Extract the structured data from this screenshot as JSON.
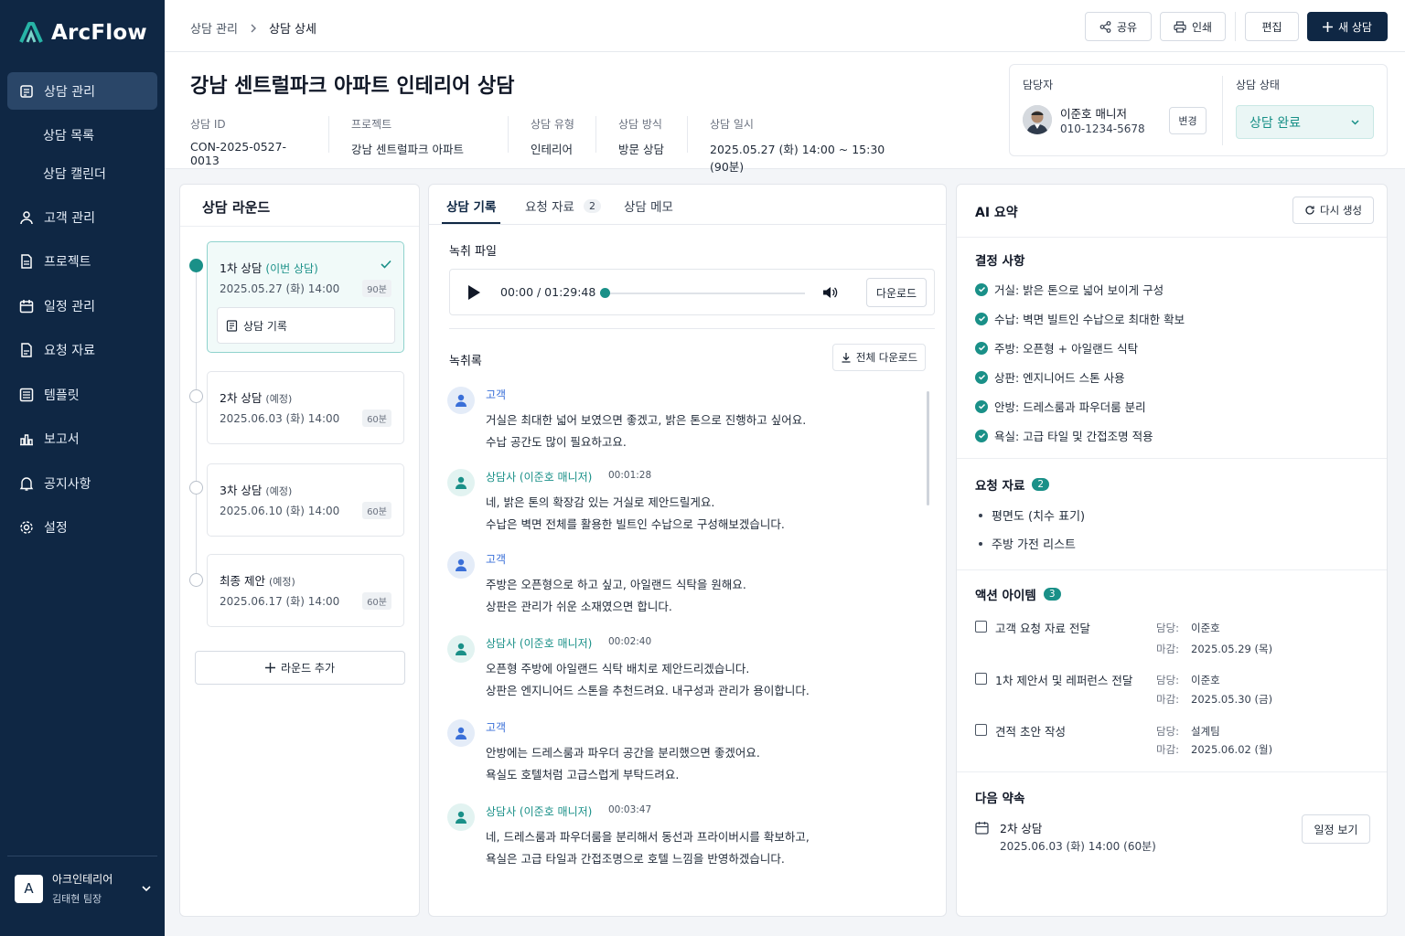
{
  "app": {
    "name": "ArcFlow"
  },
  "sidebar": {
    "items": [
      {
        "label": "상담 관리",
        "icon": "consult-icon",
        "active": true
      },
      {
        "label": "상담 목록",
        "sub": true
      },
      {
        "label": "상담 캘린더",
        "sub": true
      },
      {
        "label": "고객 관리",
        "icon": "user-icon"
      },
      {
        "label": "프로젝트",
        "icon": "document-icon"
      },
      {
        "label": "일정 관리",
        "icon": "calendar-icon"
      },
      {
        "label": "요청 자료",
        "icon": "file-icon"
      },
      {
        "label": "템플릿",
        "icon": "template-icon"
      },
      {
        "label": "보고서",
        "icon": "chart-icon"
      },
      {
        "label": "공지사항",
        "icon": "bell-icon"
      },
      {
        "label": "설정",
        "icon": "gear-icon"
      }
    ],
    "org": {
      "initial": "A",
      "name": "아크인테리어",
      "user": "김태현 팀장"
    }
  },
  "topbar": {
    "breadcrumb": [
      "상담 관리",
      "상담 상세"
    ],
    "share": "공유",
    "print": "인쇄",
    "edit": "편집",
    "new": "새 상담"
  },
  "header": {
    "title": "강남 센트럴파크 아파트 인테리어 상담",
    "meta": [
      {
        "label": "상담 ID",
        "value": "CON-2025-0527-0013"
      },
      {
        "label": "프로젝트",
        "value": "강남 센트럴파크 아파트"
      },
      {
        "label": "상담 유형",
        "value": "인테리어"
      },
      {
        "label": "상담 방식",
        "value": "방문 상담"
      },
      {
        "label": "상담 일시",
        "value": "2025.05.27 (화) 14:00 ~ 15:30 (90분)"
      }
    ],
    "owner_label": "담당자",
    "owner_name": "이준호 매니저",
    "owner_phone": "010-1234-5678",
    "change": "변경",
    "status_label": "상담 상태",
    "status": "상담 완료"
  },
  "rounds": {
    "title": "상담 라운드",
    "items": [
      {
        "title": "1차 상담",
        "tag": "(이번 상담)",
        "date": "2025.05.27 (화) 14:00",
        "dur": "90분",
        "record": "상담 기록"
      },
      {
        "title": "2차 상담",
        "tag": "(예정)",
        "date": "2025.06.03 (화) 14:00",
        "dur": "60분"
      },
      {
        "title": "3차 상담",
        "tag": "(예정)",
        "date": "2025.06.10 (화) 14:00",
        "dur": "60분"
      },
      {
        "title": "최종 제안",
        "tag": "(예정)",
        "date": "2025.06.17 (화) 14:00",
        "dur": "60분"
      }
    ],
    "add": "라운드 추가"
  },
  "records": {
    "tabs": [
      {
        "label": "상담 기록"
      },
      {
        "label": "요청 자료",
        "count": "2"
      },
      {
        "label": "상담 메모"
      }
    ],
    "audio_label": "녹취 파일",
    "audio_time": "00:00 / 01:29:48",
    "audio_progress": 0,
    "audio_download": "다운로드",
    "transcript_label": "녹취록",
    "download_all": "전체 다운로드",
    "messages": [
      {
        "who": "고객",
        "type": "cust",
        "ts": "",
        "lines": [
          "거실은 최대한 넓어 보였으면 좋겠고, 밝은 톤으로 진행하고 싶어요.",
          "수납 공간도 많이 필요하고요."
        ]
      },
      {
        "who": "상담사 (이준호 매니저)",
        "type": "agent",
        "ts": "00:01:28",
        "lines": [
          "네, 밝은 톤의 확장감 있는 거실로 제안드릴게요.",
          "수납은 벽면 전체를 활용한 빌트인 수납으로 구성해보겠습니다."
        ]
      },
      {
        "who": "고객",
        "type": "cust",
        "ts": "",
        "lines": [
          "주방은 오픈형으로 하고 싶고, 아일랜드 식탁을 원해요.",
          "상판은 관리가 쉬운 소재였으면 합니다."
        ]
      },
      {
        "who": "상담사 (이준호 매니저)",
        "type": "agent",
        "ts": "00:02:40",
        "lines": [
          "오픈형 주방에 아일랜드 식탁 배치로 제안드리겠습니다.",
          "상판은 엔지니어드 스톤을 추천드려요. 내구성과 관리가 용이합니다."
        ]
      },
      {
        "who": "고객",
        "type": "cust",
        "ts": "",
        "lines": [
          "안방에는 드레스룸과 파우더 공간을 분리했으면 좋겠어요.",
          "욕실도 호텔처럼 고급스럽게 부탁드려요."
        ]
      },
      {
        "who": "상담사 (이준호 매니저)",
        "type": "agent",
        "ts": "00:03:47",
        "lines": [
          "네, 드레스룸과 파우더룸을 분리해서 동선과 프라이버시를 확보하고,",
          "욕실은 고급 타일과 간접조명으로 호텔 느낌을 반영하겠습니다."
        ]
      }
    ]
  },
  "ai": {
    "title": "AI 요약",
    "regen": "다시 생성",
    "decisions_title": "결정 사항",
    "decisions": [
      "거실: 밝은 톤으로 넓어 보이게 구성",
      "수납: 벽면 빌트인 수납으로 최대한 확보",
      "주방: 오픈형 + 아일랜드 식탁",
      "상판: 엔지니어드 스톤 사용",
      "안방: 드레스룸과 파우더룸 분리",
      "욕실: 고급 타일 및 간접조명 적용"
    ],
    "requests_title": "요청 자료",
    "requests_count": "2",
    "requests": [
      "평면도 (치수 표기)",
      "주방 가전 리스트"
    ],
    "actions_title": "액션 아이템",
    "actions_count": "3",
    "owner_key": "담당:",
    "due_key": "마감:",
    "actions": [
      {
        "label": "고객 요청 자료 전달",
        "owner": "이준호",
        "due": "2025.05.29 (목)"
      },
      {
        "label": "1차 제안서 및 레퍼런스 전달",
        "owner": "이준호",
        "due": "2025.05.30 (금)"
      },
      {
        "label": "견적 초안 작성",
        "owner": "설계팀",
        "due": "2025.06.02 (월)"
      }
    ],
    "next_title": "다음 약속",
    "next_item": "2차 상담",
    "next_date": "2025.06.03 (화) 14:00 (60분)",
    "next_btn": "일정 보기"
  },
  "colors": {
    "navy": "#0f2744",
    "teal": "#1a9088",
    "blue": "#3a6fd8"
  }
}
